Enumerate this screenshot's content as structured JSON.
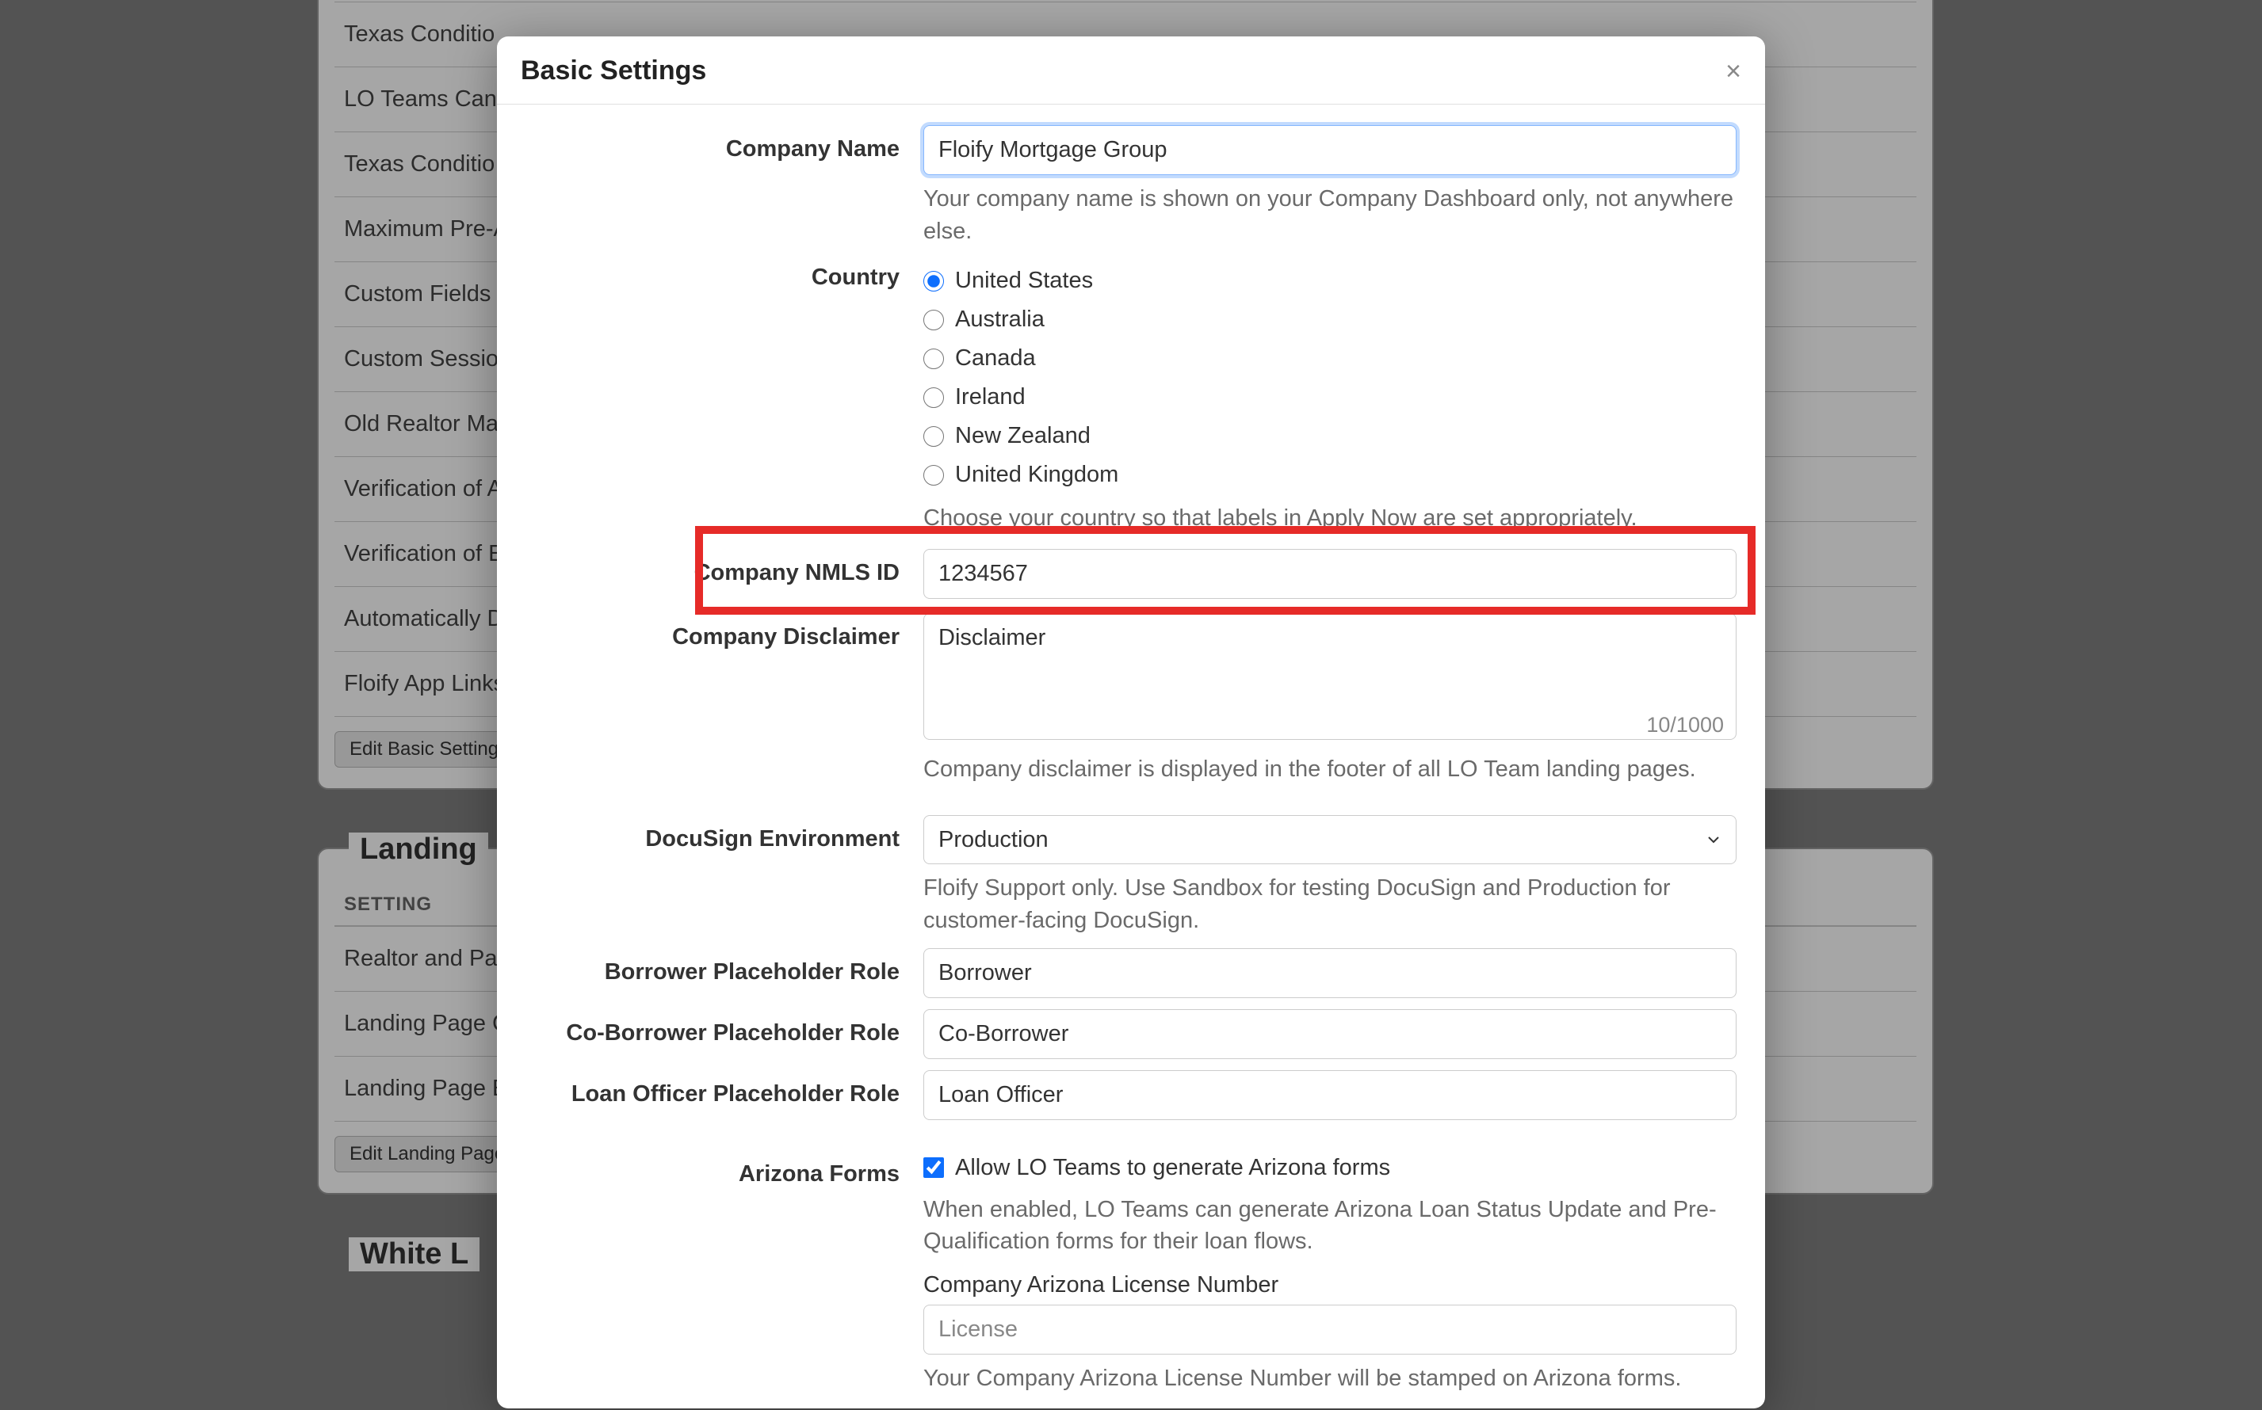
{
  "modal": {
    "title": "Basic Settings",
    "close_symbol": "×",
    "company_name": {
      "label": "Company Name",
      "value": "Floify Mortgage Group",
      "help": "Your company name is shown on your Company Dashboard only, not anywhere else."
    },
    "country": {
      "label": "Country",
      "options": [
        "United States",
        "Australia",
        "Canada",
        "Ireland",
        "New Zealand",
        "United Kingdom"
      ],
      "selected": "United States",
      "help": "Choose your country so that labels in Apply Now are set appropriately."
    },
    "nmls_id": {
      "label": "Company NMLS ID",
      "value": "1234567"
    },
    "disclaimer": {
      "label": "Company Disclaimer",
      "value": "Disclaimer",
      "counter": "10/1000",
      "help": "Company disclaimer is displayed in the footer of all LO Team landing pages."
    },
    "docusign_env": {
      "label": "DocuSign Environment",
      "selected": "Production",
      "help": "Floify Support only. Use Sandbox for testing DocuSign and Production for customer-facing DocuSign."
    },
    "borrower_role": {
      "label": "Borrower Placeholder Role",
      "value": "Borrower"
    },
    "co_borrower_role": {
      "label": "Co-Borrower Placeholder Role",
      "value": "Co-Borrower"
    },
    "loan_officer_role": {
      "label": "Loan Officer Placeholder Role",
      "value": "Loan Officer"
    },
    "arizona": {
      "label": "Arizona Forms",
      "checkbox_label": "Allow LO Teams to generate Arizona forms",
      "checked": true,
      "help": "When enabled, LO Teams can generate Arizona Loan Status Update and Pre-Qualification forms for their loan flows.",
      "license_label": "Company Arizona License Number",
      "license_placeholder": "License",
      "license_help": "Your Company Arizona License Number will be stamped on Arizona forms."
    }
  },
  "background": {
    "rows_upper": [
      "Texas Conditio",
      "LO Teams Can",
      "Texas Conditio",
      "Maximum Pre-A",
      "Custom Fields a",
      "Custom Session",
      "Old Realtor Ma",
      "Verification of A",
      "Verification of E",
      "Automatically D",
      "Floify App Links"
    ],
    "btn_edit_basic": "Edit Basic Settings",
    "fieldset_landing": "Landing",
    "landing_header": "SETTING",
    "rows_landing": [
      "Realtor and Par",
      "Landing Page C",
      "Landing Page E"
    ],
    "btn_edit_landing": "Edit Landing Page",
    "fieldset_white": "White L"
  }
}
